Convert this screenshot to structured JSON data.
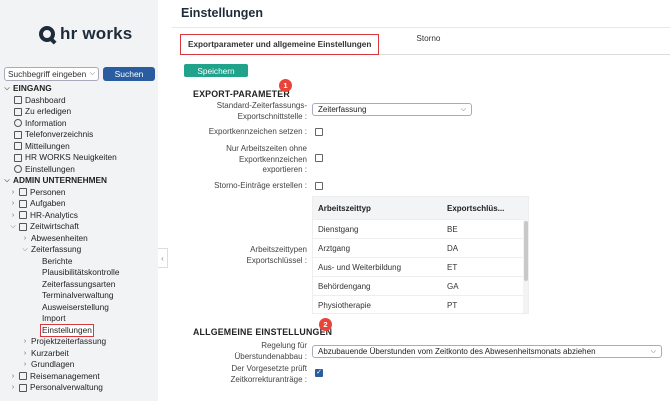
{
  "logo": {
    "text": "hr works"
  },
  "search": {
    "placeholder": "Suchbegriff eingeben",
    "button": "Suchen"
  },
  "sidebar": {
    "items": [
      {
        "label": "EINGANG",
        "type": "section"
      },
      {
        "label": "Dashboard",
        "icon": "dashboard-icon"
      },
      {
        "label": "Zu erledigen",
        "icon": "todo-icon"
      },
      {
        "label": "Information",
        "icon": "info-icon"
      },
      {
        "label": "Telefonverzeichnis",
        "icon": "phone-book-icon"
      },
      {
        "label": "Mitteilungen",
        "icon": "message-icon"
      },
      {
        "label": "HR WORKS Neuigkeiten",
        "icon": "news-icon"
      },
      {
        "label": "Einstellungen",
        "icon": "settings-icon"
      },
      {
        "label": "ADMIN UNTERNEHMEN",
        "type": "section"
      },
      {
        "label": "Personen",
        "icon": "people-icon"
      },
      {
        "label": "Aufgaben",
        "icon": "tasks-icon"
      },
      {
        "label": "HR-Analytics",
        "icon": "analytics-icon"
      },
      {
        "label": "Zeitwirtschaft",
        "icon": "time-icon"
      },
      {
        "label": "Abwesenheiten"
      },
      {
        "label": "Zeiterfassung"
      },
      {
        "label": "Berichte"
      },
      {
        "label": "Plausibilitätskontrolle"
      },
      {
        "label": "Zeiterfassungsarten"
      },
      {
        "label": "Terminalverwaltung"
      },
      {
        "label": "Ausweiserstellung"
      },
      {
        "label": "Import"
      },
      {
        "label": "Einstellungen"
      },
      {
        "label": "Projektzeiterfassung"
      },
      {
        "label": "Kurzarbeit"
      },
      {
        "label": "Grundlagen"
      },
      {
        "label": "Reisemanagement",
        "icon": "travel-icon"
      },
      {
        "label": "Personalverwaltung",
        "icon": "hr-icon"
      }
    ]
  },
  "header": {
    "title": "Einstellungen"
  },
  "tabs": [
    {
      "label": "Exportparameter und allgemeine Einstellungen",
      "active": true
    },
    {
      "label": "Storno",
      "active": false
    }
  ],
  "actions": {
    "save": "Speichern"
  },
  "badges": [
    "1",
    "2"
  ],
  "export": {
    "heading": "EXPORT-PARAMETER",
    "interface_label": "Standard-Zeiterfassungs-Exportschnittstelle :",
    "interface_value": "Zeiterfassung",
    "export_codes_label": "Exportkennzeichen setzen :",
    "only_with_codes_label": "Nur Arbeitszeiten ohne Exportkennzeichen exportieren :",
    "storno_label": "Storno-Einträge erstellen :",
    "table_label": "Arbeitszeittypen Exportschlüssel :",
    "table": {
      "headers": [
        "Arbeitszeittyp",
        "Exportschlüs..."
      ],
      "rows": [
        [
          "Dienstgang",
          "BE"
        ],
        [
          "Arztgang",
          "DA"
        ],
        [
          "Aus- und Weiterbildung",
          "ET"
        ],
        [
          "Behördengang",
          "GA"
        ],
        [
          "Physiotherapie",
          "PT"
        ]
      ]
    }
  },
  "general": {
    "heading": "ALLGEMEINE EINSTELLUNGEN",
    "overtime_label": "Regelung für Überstundenabbau :",
    "overtime_value": "Abzubauende Überstunden vom Zeitkonto des Abwesenheitsmonats abziehen",
    "supervisor_label": "Der Vorgesetzte prüft Zeitkorrekturanträge :"
  },
  "colors": {
    "accent": "#20a28b",
    "brand": "#2a5d9f",
    "highlight": "#d9363e"
  }
}
